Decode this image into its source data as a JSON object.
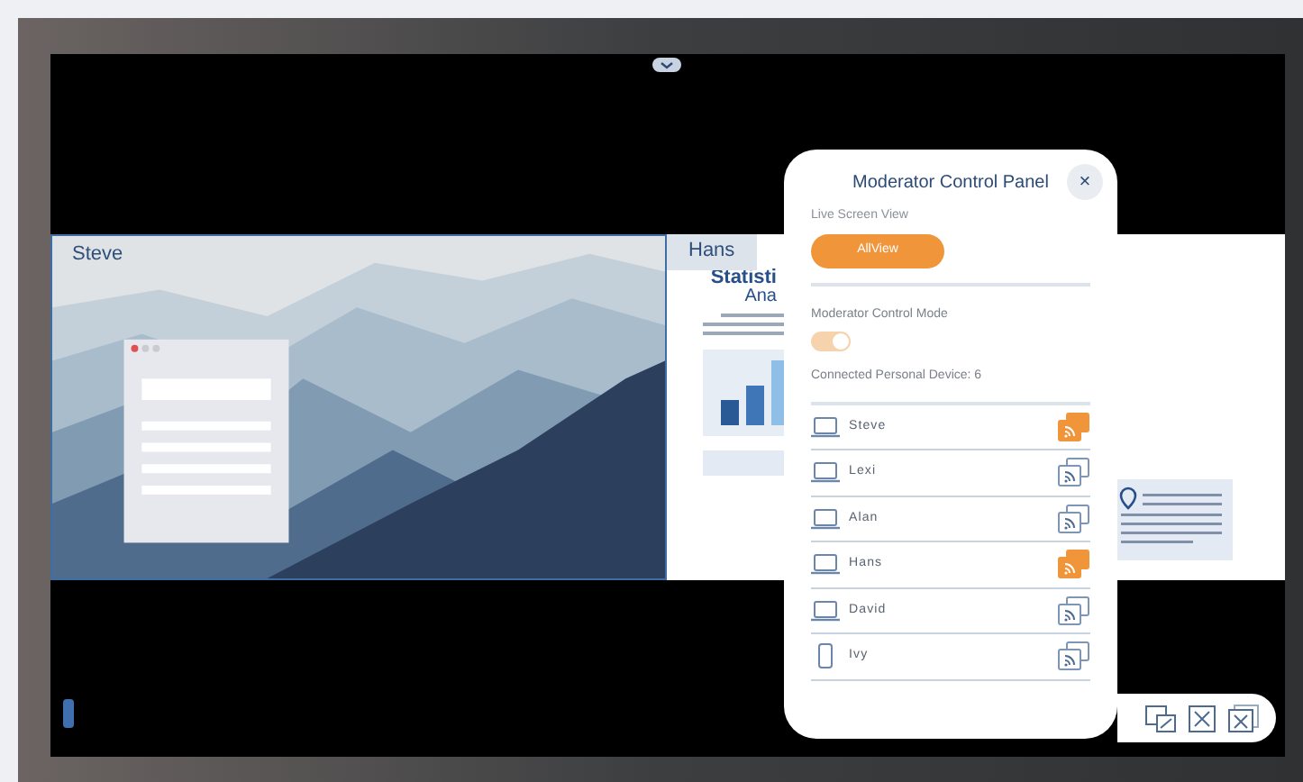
{
  "tiles": [
    {
      "label": "Steve",
      "kind": "picture"
    },
    {
      "label": "Hans",
      "kind": "document",
      "doc_title": "Statisti",
      "doc_subtitle": "Ana"
    }
  ],
  "panel": {
    "title": "Moderator Control Panel",
    "close": "×",
    "live_label": "Live Screen View",
    "view_button": "AllView",
    "mode_label": "Moderator Control Mode",
    "mode_on": true,
    "devices_label": "Connected Personal Device: 6",
    "devices": [
      {
        "name": "Steve",
        "kind": "laptop",
        "casting": true
      },
      {
        "name": "Lexi",
        "kind": "laptop",
        "casting": false
      },
      {
        "name": "Alan",
        "kind": "laptop",
        "casting": false
      },
      {
        "name": "Hans",
        "kind": "laptop",
        "casting": true
      },
      {
        "name": "David",
        "kind": "laptop",
        "casting": false
      },
      {
        "name": "Ivy",
        "kind": "phone",
        "casting": false
      }
    ]
  }
}
